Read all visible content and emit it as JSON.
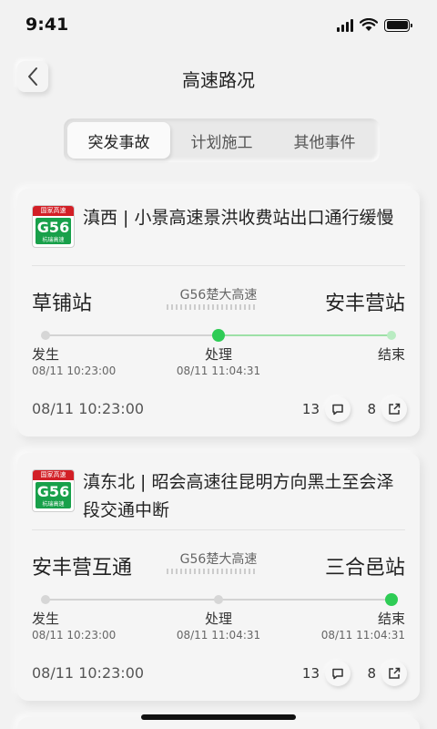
{
  "status_bar": {
    "time": "9:41"
  },
  "header": {
    "title": "高速路况"
  },
  "tabs": [
    {
      "label": "突发事故",
      "active": true
    },
    {
      "label": "计划施工",
      "active": false
    },
    {
      "label": "其他事件",
      "active": false
    }
  ],
  "cards": [
    {
      "shield": {
        "top_text": "国家高速",
        "code": "G56",
        "sub_text": "杭瑞高速"
      },
      "title": "滇西 | 小景高速景洪收费站出口通行缓慢",
      "from": "草铺站",
      "road": "G56楚大高速",
      "to": "安丰营站",
      "steps": [
        {
          "label": "发生",
          "time": "08/11 10:23:00"
        },
        {
          "label": "处理",
          "time": "08/11 11:04:31"
        },
        {
          "label": "结束",
          "time": ""
        }
      ],
      "current_step": "处理",
      "date": "08/11 10:23:00",
      "comments": "13",
      "shares": "8"
    },
    {
      "shield": {
        "top_text": "国家高速",
        "code": "G56",
        "sub_text": "杭瑞高速"
      },
      "title": "滇东北 | 昭会高速往昆明方向黑土至会泽段交通中断",
      "from": "安丰营互通",
      "road": "G56楚大高速",
      "to": "三合邑站",
      "steps": [
        {
          "label": "发生",
          "time": "08/11 10:23:00"
        },
        {
          "label": "处理",
          "time": "08/11 11:04:31"
        },
        {
          "label": "结束",
          "time": "08/11 11:04:31"
        }
      ],
      "current_step": "结束",
      "date": "08/11 10:23:00",
      "comments": "13",
      "shares": "8"
    }
  ],
  "colors": {
    "accent_green": "#2ecc55",
    "shield_green": "#18a04a",
    "shield_red": "#d21f26"
  },
  "icons": {
    "back": "chevron-left-icon",
    "comment": "comment-icon",
    "share": "share-icon",
    "wifi": "wifi-icon",
    "signal": "signal-icon",
    "battery": "battery-icon"
  }
}
